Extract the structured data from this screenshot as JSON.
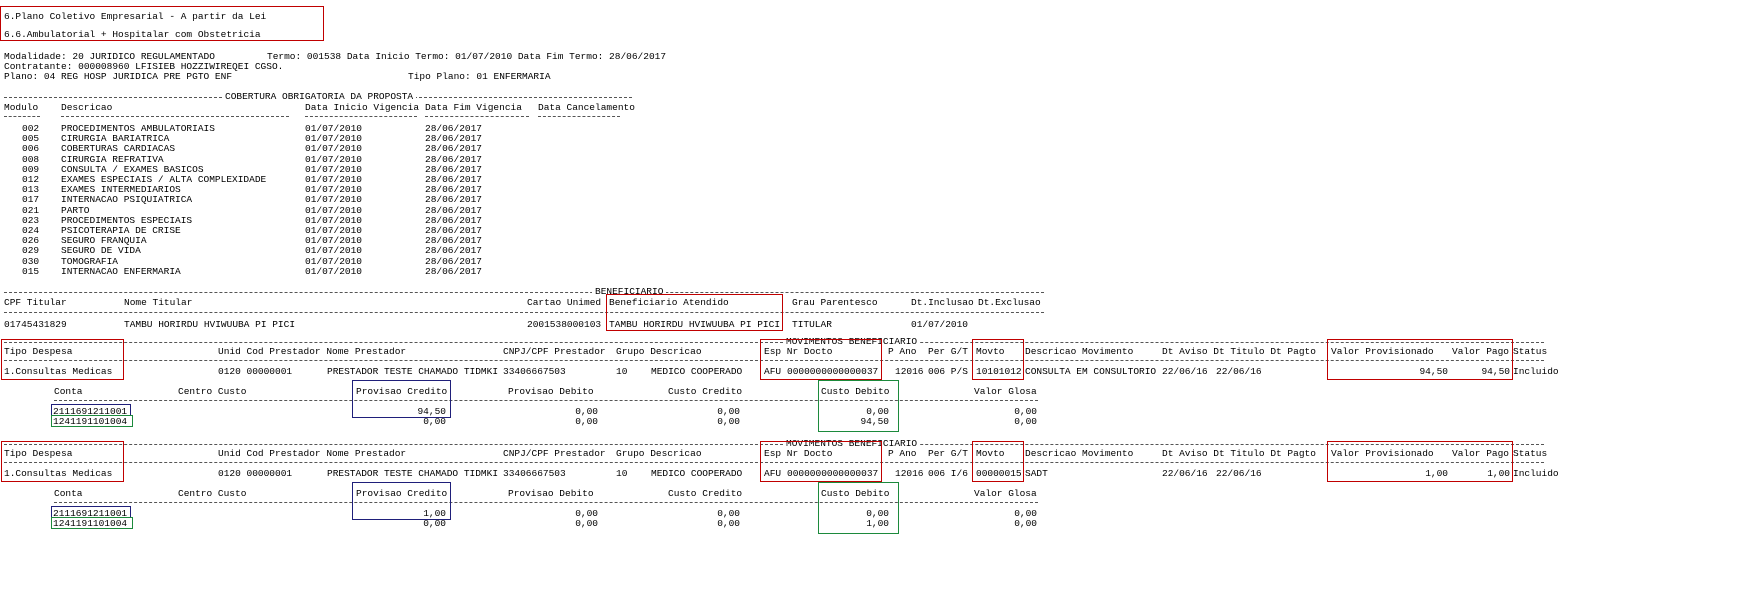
{
  "header": {
    "plan_line": "6.Plano Coletivo Empresarial - A partir da Lei",
    "segment_line": "6.6.Ambulatorial + Hospitalar com Obstetricia",
    "modalidade": "Modalidade: 20 JURIDICO REGULAMENTADO",
    "termo": "Termo: 001538 Data Inicio Termo: 01/07/2010 Data Fim Termo: 28/06/2017",
    "contratante": "Contratante: 000008960 LFISIEB HOZZIWIREQEI CGSO.",
    "plano": "Plano: 04 REG HOSP JURIDICA PRE PGTO ENF",
    "tipo_plano": "Tipo Plano: 01 ENFERMARIA"
  },
  "cobertura": {
    "section_title": "COBERTURA OBRIGATORIA DA PROPOSTA",
    "columns": [
      "Modulo",
      "Descricao",
      "Data Inicio Vigencia",
      "Data Fim Vigencia",
      "Data Cancelamento"
    ],
    "rows": [
      {
        "modulo": "002",
        "descricao": "PROCEDIMENTOS AMBULATORIAIS",
        "inicio": "01/07/2010",
        "fim": "28/06/2017"
      },
      {
        "modulo": "005",
        "descricao": "CIRURGIA BARIATRICA",
        "inicio": "01/07/2010",
        "fim": "28/06/2017"
      },
      {
        "modulo": "006",
        "descricao": "COBERTURAS CARDIACAS",
        "inicio": "01/07/2010",
        "fim": "28/06/2017"
      },
      {
        "modulo": "008",
        "descricao": "CIRURGIA REFRATIVA",
        "inicio": "01/07/2010",
        "fim": "28/06/2017"
      },
      {
        "modulo": "009",
        "descricao": "CONSULTA / EXAMES BASICOS",
        "inicio": "01/07/2010",
        "fim": "28/06/2017"
      },
      {
        "modulo": "012",
        "descricao": "EXAMES ESPECIAIS / ALTA COMPLEXIDADE",
        "inicio": "01/07/2010",
        "fim": "28/06/2017"
      },
      {
        "modulo": "013",
        "descricao": "EXAMES INTERMEDIARIOS",
        "inicio": "01/07/2010",
        "fim": "28/06/2017"
      },
      {
        "modulo": "017",
        "descricao": "INTERNACAO PSIQUIATRICA",
        "inicio": "01/07/2010",
        "fim": "28/06/2017"
      },
      {
        "modulo": "021",
        "descricao": "PARTO",
        "inicio": "01/07/2010",
        "fim": "28/06/2017"
      },
      {
        "modulo": "023",
        "descricao": "PROCEDIMENTOS ESPECIAIS",
        "inicio": "01/07/2010",
        "fim": "28/06/2017"
      },
      {
        "modulo": "024",
        "descricao": "PSICOTERAPIA DE CRISE",
        "inicio": "01/07/2010",
        "fim": "28/06/2017"
      },
      {
        "modulo": "026",
        "descricao": "SEGURO FRANQUIA",
        "inicio": "01/07/2010",
        "fim": "28/06/2017"
      },
      {
        "modulo": "029",
        "descricao": "SEGURO DE VIDA",
        "inicio": "01/07/2010",
        "fim": "28/06/2017"
      },
      {
        "modulo": "030",
        "descricao": "TOMOGRAFIA",
        "inicio": "01/07/2010",
        "fim": "28/06/2017"
      },
      {
        "modulo": "015",
        "descricao": "INTERNACAO ENFERMARIA",
        "inicio": "01/07/2010",
        "fim": "28/06/2017"
      }
    ]
  },
  "beneficiario": {
    "section_title": "BENEFICIARIO",
    "columns": {
      "cpf": "CPF Titular",
      "nome": "Nome Titular",
      "cartao": "Cartao Unimed",
      "atendido": "Beneficiario Atendido",
      "grau": "Grau Parentesco",
      "inclusao": "Dt.Inclusao",
      "exclusao": "Dt.Exclusao"
    },
    "row": {
      "cpf": "01745431829",
      "nome": "TAMBU HORIRDU HVIWUUBA PI PICI",
      "cartao": "2001538000103",
      "atendido": "TAMBU HORIRDU HVIWUUBA PI PICI",
      "grau": "TITULAR",
      "inclusao": "01/07/2010"
    }
  },
  "movimentos": {
    "section_title": "MOVIMENTOS BENEFICIARIO",
    "columns": {
      "tipo": "Tipo Despesa",
      "unid": "Unid Cod Prestador Nome Prestador",
      "cnpj": "CNPJ/CPF Prestador",
      "grupo": "Grupo Descricao",
      "esp": "Esp Nr Docto",
      "pano": "P Ano",
      "per": "Per G/T",
      "movto": "Movto",
      "desc_mov": "Descricao Movimento",
      "datas": "Dt Aviso Dt Titulo Dt Pagto",
      "valor_prov": "Valor Provisionado",
      "valor_pago": "Valor Pago",
      "status": "Status"
    },
    "acct_columns": {
      "conta": "Conta",
      "centro": "Centro Custo",
      "prov_cred": "Provisao Credito",
      "prov_deb": "Provisao Debito",
      "custo_cred": "Custo Credito",
      "custo_deb": "Custo Debito",
      "glosa": "Valor Glosa"
    },
    "blocks": [
      {
        "row": {
          "tipo": "1.Consultas Medicas",
          "unid": "0120 00000001",
          "prestador": "PRESTADOR TESTE CHAMADO TIDMKI",
          "cnpj": "33406667503",
          "grupo": "10",
          "descricao": "MEDICO COOPERADO",
          "esp": "AFU",
          "docto": "0000000000000037",
          "ano": "12016",
          "per": "006 P/S",
          "movto": "10101012",
          "desc_mov": "CONSULTA EM CONSULTORIO",
          "dt_aviso": "22/06/16",
          "dt_titulo": "22/06/16",
          "valor_prov": "94,50",
          "valor_pago": "94,50",
          "status": "Incluido"
        },
        "accounts": [
          {
            "conta": "2111691211001",
            "prov_cred": "94,50",
            "prov_deb": "0,00",
            "custo_cred": "0,00",
            "custo_deb": "0,00",
            "glosa": "0,00"
          },
          {
            "conta": "1241191101004",
            "prov_cred": "0,00",
            "prov_deb": "0,00",
            "custo_cred": "0,00",
            "custo_deb": "94,50",
            "glosa": "0,00"
          }
        ]
      },
      {
        "row": {
          "tipo": "1.Consultas Medicas",
          "unid": "0120 00000001",
          "prestador": "PRESTADOR TESTE CHAMADO TIDMKI",
          "cnpj": "33406667503",
          "grupo": "10",
          "descricao": "MEDICO COOPERADO",
          "esp": "AFU",
          "docto": "0000000000000037",
          "ano": "12016",
          "per": "006 I/6",
          "movto": "00000015",
          "desc_mov": "SADT",
          "dt_aviso": "22/06/16",
          "dt_titulo": "22/06/16",
          "valor_prov": "1,00",
          "valor_pago": "1,00",
          "status": "Incluido"
        },
        "accounts": [
          {
            "conta": "2111691211001",
            "prov_cred": "1,00",
            "prov_deb": "0,00",
            "custo_cred": "0,00",
            "custo_deb": "0,00",
            "glosa": "0,00"
          },
          {
            "conta": "1241191101004",
            "prov_cred": "0,00",
            "prov_deb": "0,00",
            "custo_cred": "0,00",
            "custo_deb": "1,00",
            "glosa": "0,00"
          }
        ]
      }
    ]
  }
}
